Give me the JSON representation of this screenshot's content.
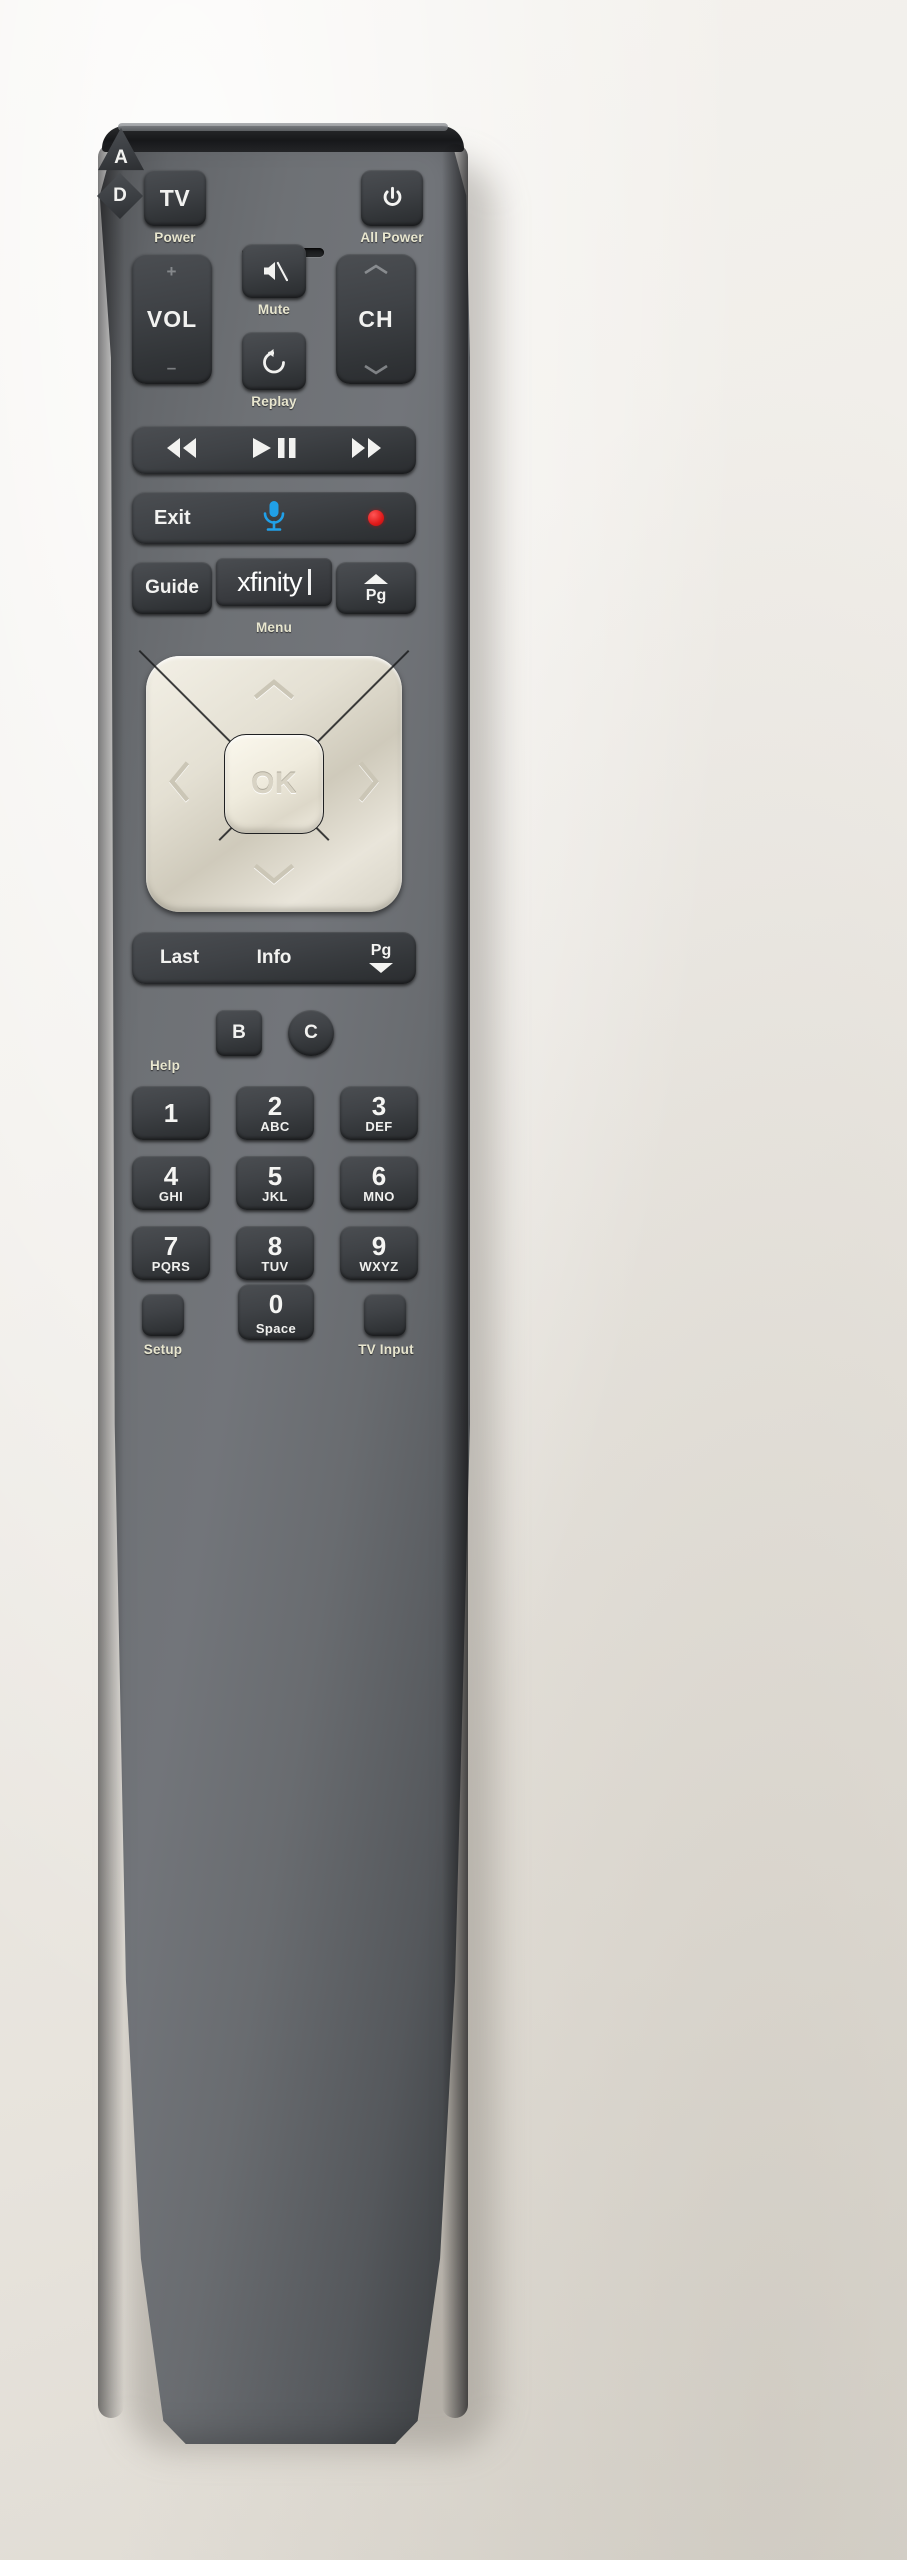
{
  "device": {
    "brand": "xfinity",
    "type": "remote-control",
    "model_family": "Xfinity Voice Remote"
  },
  "colors": {
    "body_gray": "#6e7175",
    "key_dark": "#3f4246",
    "label_cream": "#e8e6cf",
    "key_text": "#f2f2f0",
    "mic_blue": "#20a0e8",
    "record_red": "#e01a1a",
    "dpad_silver": "#e4e0d3"
  },
  "top_row": {
    "tv_label": "TV",
    "tv_caption": "Power",
    "ir_slot": "ir-window",
    "all_power_icon": "power-icon",
    "all_power_caption": "All Power"
  },
  "volume_row": {
    "vol_label": "VOL",
    "vol_up_mark": "+",
    "vol_down_mark": "–",
    "ch_label": "CH",
    "ch_up_icon": "chevron-up-icon",
    "ch_down_icon": "chevron-down-icon",
    "mute_icon": "mute-icon",
    "mute_caption": "Mute",
    "replay_icon": "replay-icon",
    "replay_caption": "Replay"
  },
  "transport_row": {
    "rewind_icon": "rewind-icon",
    "play_pause_icon": "play-pause-icon",
    "fast_forward_icon": "fast-forward-icon"
  },
  "exit_row": {
    "exit_label": "Exit",
    "mic_icon": "microphone-icon",
    "record_icon": "record-dot-icon"
  },
  "menu_row": {
    "guide_label": "Guide",
    "xfinity_label": "xfinity",
    "page_up_label": "Pg",
    "page_up_icon": "triangle-up-icon",
    "menu_caption": "Menu"
  },
  "dpad": {
    "up_icon": "chevron-up-icon",
    "down_icon": "chevron-down-icon",
    "left_icon": "chevron-left-icon",
    "right_icon": "chevron-right-icon",
    "ok_label": "OK"
  },
  "info_row": {
    "last_label": "Last",
    "info_label": "Info",
    "page_down_label": "Pg",
    "page_down_icon": "triangle-down-icon"
  },
  "abcd_row": {
    "buttons": [
      {
        "label": "A",
        "shape": "triangle"
      },
      {
        "label": "B",
        "shape": "square"
      },
      {
        "label": "C",
        "shape": "circle"
      },
      {
        "label": "D",
        "shape": "diamond"
      }
    ],
    "help_caption": "Help"
  },
  "keypad": {
    "keys": [
      {
        "digit": "1",
        "letters": ""
      },
      {
        "digit": "2",
        "letters": "ABC"
      },
      {
        "digit": "3",
        "letters": "DEF"
      },
      {
        "digit": "4",
        "letters": "GHI"
      },
      {
        "digit": "5",
        "letters": "JKL"
      },
      {
        "digit": "6",
        "letters": "MNO"
      },
      {
        "digit": "7",
        "letters": "PQRS"
      },
      {
        "digit": "8",
        "letters": "TUV"
      },
      {
        "digit": "9",
        "letters": "WXYZ"
      }
    ]
  },
  "bottom_row": {
    "setup_caption": "Setup",
    "zero_digit": "0",
    "zero_letters": "Space",
    "tv_input_caption": "TV Input"
  }
}
